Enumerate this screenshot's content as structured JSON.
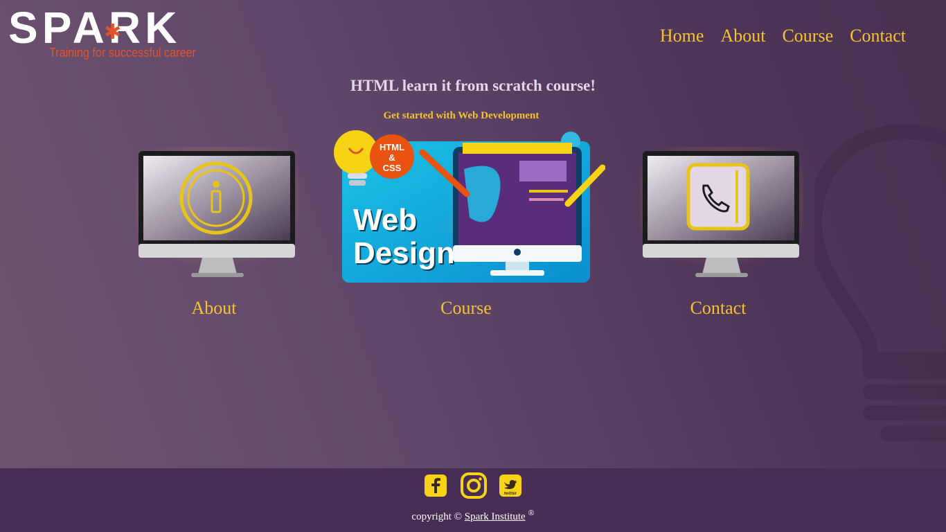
{
  "header": {
    "logo_text": "SPARK",
    "logo_tagline": "Training for successful career",
    "nav": [
      {
        "label": "Home"
      },
      {
        "label": "About"
      },
      {
        "label": "Course"
      },
      {
        "label": "Contact"
      }
    ]
  },
  "hero": {
    "title": "HTML learn it from scratch course!",
    "subtitle": "Get started with Web Development"
  },
  "cards": [
    {
      "label": "About",
      "icon": "info-icon"
    },
    {
      "label": "Course",
      "banner_badge": "HTML & CSS",
      "banner_title_1": "Web",
      "banner_title_2": "Design"
    },
    {
      "label": "Contact",
      "icon": "phone-icon"
    }
  ],
  "footer": {
    "social": [
      "facebook-icon",
      "instagram-icon",
      "twitter-icon"
    ],
    "twitter_text": "twitter",
    "copyright_prefix": "copyright © ",
    "copyright_link": "Spark Institute",
    "copyright_mark": "®"
  },
  "colors": {
    "accent": "#f4c430",
    "logo_orange": "#e2532b",
    "footer_bg": "#482e55"
  }
}
